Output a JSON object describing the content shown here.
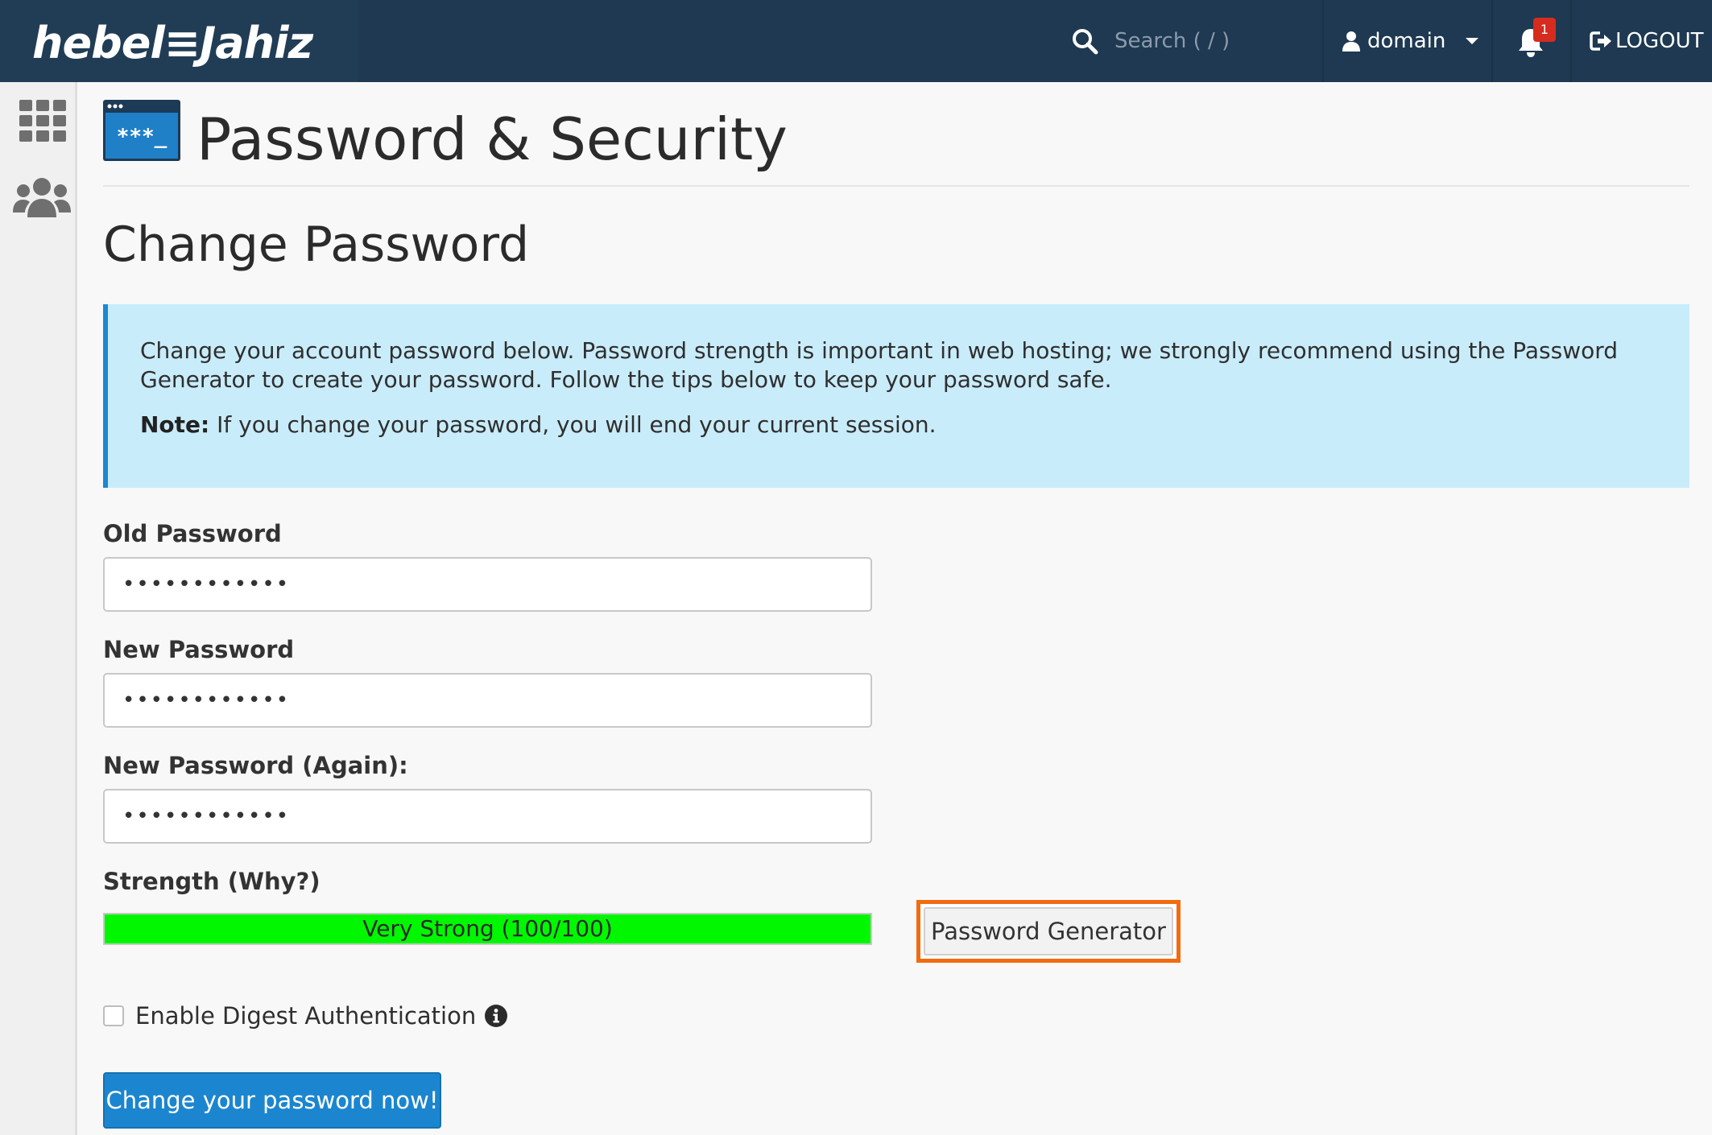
{
  "brand": {
    "logo_text": "hebel≡Jahiz"
  },
  "topbar": {
    "search_placeholder": "Search ( / )",
    "user_label": "domain",
    "notification_count": "1",
    "logout_label": "LOGOUT"
  },
  "sidebar": {
    "items": [
      {
        "icon": "grid-icon"
      },
      {
        "icon": "users-icon"
      }
    ]
  },
  "page": {
    "icon_text": "***_",
    "title": "Password & Security",
    "section_title": "Change Password"
  },
  "info": {
    "text": "Change your account password below. Password strength is important in web hosting; we strongly recommend using the Password Generator to create your password. Follow the tips below to keep your password safe.",
    "note_label": "Note:",
    "note_text": " If you change your password, you will end your current session."
  },
  "form": {
    "old_password_label": "Old Password",
    "old_password_value": "••••••••••••",
    "new_password_label": "New Password",
    "new_password_value": "••••••••••••",
    "new_password_again_label": "New Password (Again):",
    "new_password_again_value": "••••••••••••",
    "strength_label": "Strength (Why?)",
    "strength_text": "Very Strong (100/100)",
    "strength_percent": 100,
    "generator_label": "Password Generator",
    "digest_label": "Enable Digest Authentication",
    "digest_checked": false,
    "submit_label": "Change your password now!"
  },
  "colors": {
    "topbar": "#1e3951",
    "accent": "#1b86cf",
    "strength": "#00f700",
    "highlight": "#f26b0f",
    "info_bg": "#c9ecfa"
  }
}
